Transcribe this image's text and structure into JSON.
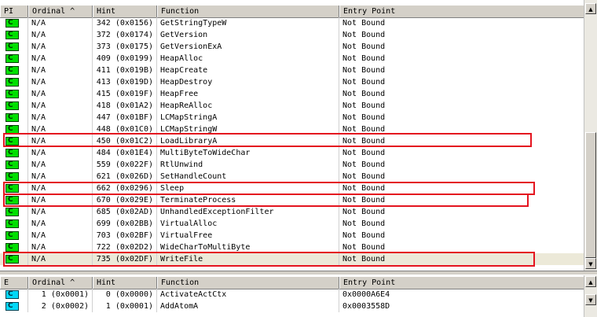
{
  "top_table": {
    "columns": {
      "pi": "PI",
      "ordinal": "Ordinal ^",
      "hint": "Hint",
      "function": "Function",
      "entry_point": "Entry Point"
    },
    "badge": "C",
    "rows": [
      {
        "ordinal": "N/A",
        "hint": "342  (0x0156)",
        "function": "GetStringTypeW",
        "entry_point": "Not Bound"
      },
      {
        "ordinal": "N/A",
        "hint": "372  (0x0174)",
        "function": "GetVersion",
        "entry_point": "Not Bound"
      },
      {
        "ordinal": "N/A",
        "hint": "373  (0x0175)",
        "function": "GetVersionExA",
        "entry_point": "Not Bound"
      },
      {
        "ordinal": "N/A",
        "hint": "409  (0x0199)",
        "function": "HeapAlloc",
        "entry_point": "Not Bound"
      },
      {
        "ordinal": "N/A",
        "hint": "411  (0x019B)",
        "function": "HeapCreate",
        "entry_point": "Not Bound"
      },
      {
        "ordinal": "N/A",
        "hint": "413  (0x019D)",
        "function": "HeapDestroy",
        "entry_point": "Not Bound"
      },
      {
        "ordinal": "N/A",
        "hint": "415  (0x019F)",
        "function": "HeapFree",
        "entry_point": "Not Bound"
      },
      {
        "ordinal": "N/A",
        "hint": "418  (0x01A2)",
        "function": "HeapReAlloc",
        "entry_point": "Not Bound"
      },
      {
        "ordinal": "N/A",
        "hint": "447  (0x01BF)",
        "function": "LCMapStringA",
        "entry_point": "Not Bound"
      },
      {
        "ordinal": "N/A",
        "hint": "448  (0x01C0)",
        "function": "LCMapStringW",
        "entry_point": "Not Bound"
      },
      {
        "ordinal": "N/A",
        "hint": "450  (0x01C2)",
        "function": "LoadLibraryA",
        "entry_point": "Not Bound"
      },
      {
        "ordinal": "N/A",
        "hint": "484  (0x01E4)",
        "function": "MultiByteToWideChar",
        "entry_point": "Not Bound"
      },
      {
        "ordinal": "N/A",
        "hint": "559  (0x022F)",
        "function": "RtlUnwind",
        "entry_point": "Not Bound"
      },
      {
        "ordinal": "N/A",
        "hint": "621  (0x026D)",
        "function": "SetHandleCount",
        "entry_point": "Not Bound"
      },
      {
        "ordinal": "N/A",
        "hint": "662  (0x0296)",
        "function": "Sleep",
        "entry_point": "Not Bound"
      },
      {
        "ordinal": "N/A",
        "hint": "670  (0x029E)",
        "function": "TerminateProcess",
        "entry_point": "Not Bound"
      },
      {
        "ordinal": "N/A",
        "hint": "685  (0x02AD)",
        "function": "UnhandledExceptionFilter",
        "entry_point": "Not Bound"
      },
      {
        "ordinal": "N/A",
        "hint": "699  (0x02BB)",
        "function": "VirtualAlloc",
        "entry_point": "Not Bound"
      },
      {
        "ordinal": "N/A",
        "hint": "703  (0x02BF)",
        "function": "VirtualFree",
        "entry_point": "Not Bound"
      },
      {
        "ordinal": "N/A",
        "hint": "722  (0x02D2)",
        "function": "WideCharToMultiByte",
        "entry_point": "Not Bound"
      },
      {
        "ordinal": "N/A",
        "hint": "735  (0x02DF)",
        "function": "WriteFile",
        "entry_point": "Not Bound"
      }
    ]
  },
  "bottom_table": {
    "columns": {
      "e": "E",
      "ordinal": "Ordinal ^",
      "hint": "Hint",
      "function": "Function",
      "entry_point": "Entry Point"
    },
    "badge": "C",
    "rows": [
      {
        "ordinal": "1  (0x0001)",
        "hint": "0  (0x0000)",
        "function": "ActivateActCtx",
        "entry_point": "0x0000A6E4"
      },
      {
        "ordinal": "2  (0x0002)",
        "hint": "1  (0x0001)",
        "function": "AddAtomA",
        "entry_point": "0x0003558D"
      }
    ]
  },
  "colors": {
    "import_badge": "#00e000",
    "export_badge": "#00d8f8",
    "highlight": "#e4141f"
  }
}
